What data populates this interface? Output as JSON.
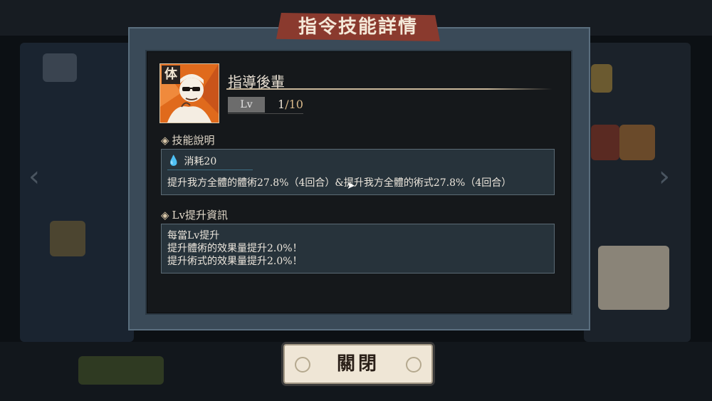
{
  "dialog": {
    "title": "指令技能詳情",
    "close_label": "關閉"
  },
  "skill": {
    "badge": "体",
    "name": "指導後輩",
    "lv_label": "Lv",
    "lv_current": "1",
    "lv_max": "/10"
  },
  "description": {
    "section_label": "技能說明",
    "cost": "消耗20",
    "text": "提升我方全體的體術27.8%（4回合）&提升我方全體的術式27.8%（4回合）"
  },
  "levelup": {
    "section_label": "Lv提升資訊",
    "lines": [
      "每當Lv提升",
      "提升體術的效果量提升2.0%！",
      "提升術式的效果量提升2.0%！"
    ]
  },
  "icons": {
    "section_marker": "diamond-icon",
    "cost": "cursed-energy-drop-icon",
    "cursor": "mouse-cursor-icon"
  },
  "colors": {
    "title_banner": "#8a3a2e",
    "skill_icon_bg": "#e06a1c",
    "panel_bg": "#27333b",
    "lv_max": "#d9b98a"
  }
}
